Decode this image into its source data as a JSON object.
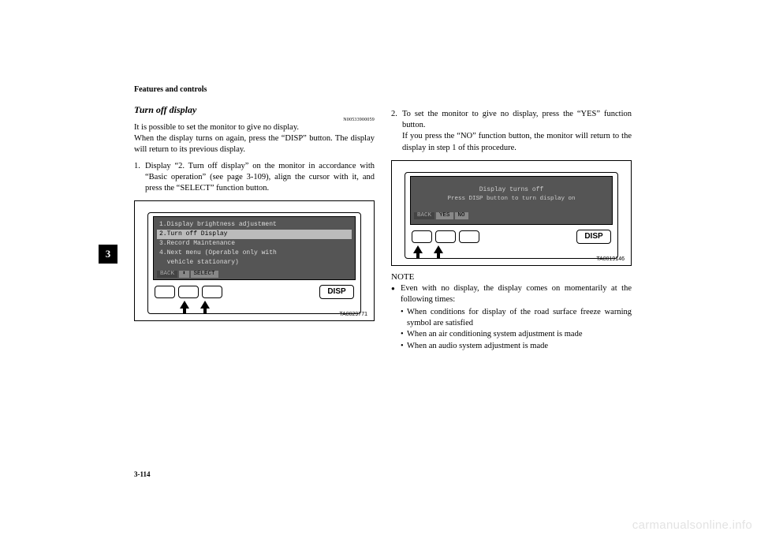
{
  "header": {
    "section": "Features and controls"
  },
  "page": {
    "number": "3-114",
    "tab": "3"
  },
  "left": {
    "title": "Turn off display",
    "ref": "N00533900059",
    "p1": "It is possible to set the monitor to give no display.",
    "p2": "When the display turns on again, press the “DISP” button. The display will return to its previous display.",
    "step1_num": "1.",
    "step1": "Display “2. Turn off display” on the monitor in accordance with “Basic operation” (see page 3-109), align the cursor with it, and press the “SELECT” function button.",
    "screen": {
      "l1": "1.Display brightness adjustment",
      "l2": "2.Turn off Display",
      "l3": "3.Record Maintenance",
      "l4": "4.Next menu (Operable only with",
      "l5": "  vehicle stationary)",
      "f_back": "BACK",
      "f_updn": "⬍",
      "f_select": "SELECT"
    },
    "disp_label": "DISP",
    "fig_id": "TA0029771"
  },
  "right": {
    "step2_num": "2.",
    "step2a": "To set the monitor to give no display, press the “YES” function button.",
    "step2b": "If you press the “NO” function button, the monitor will return to the display in step 1 of this procedure.",
    "screen": {
      "title": "Display turns off",
      "sub": "Press DISP button to turn display on",
      "f_back": "BACK",
      "f_yes": "YES",
      "f_no": "NO"
    },
    "disp_label": "DISP",
    "fig_id": "TA0019146",
    "note_h": "NOTE",
    "note_main": "Even with no display, the display comes on momentarily at the following times:",
    "note_s1": "When conditions for display of the road surface freeze warning symbol are satisfied",
    "note_s2": "When an air conditioning system adjustment is made",
    "note_s3": "When an audio system adjustment is made"
  },
  "watermark": "carmanualsonline.info"
}
